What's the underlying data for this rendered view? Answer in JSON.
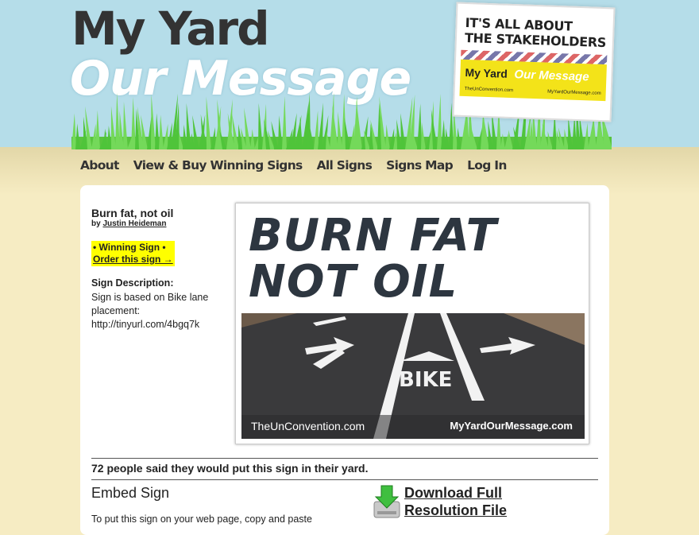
{
  "header": {
    "logo_line1": "My Yard",
    "logo_line2": "Our Message",
    "yard_sign": {
      "headline_line1": "IT'S ALL ABOUT",
      "headline_line2": "THE STAKEHOLDERS",
      "brand_left": "My Yard",
      "brand_right": "Our Message",
      "url_left": "TheUnConvention.com",
      "url_right": "MyYardOurMessage.com"
    }
  },
  "nav": {
    "items": [
      "About",
      "View & Buy Winning Signs",
      "All Signs",
      "Signs Map",
      "Log In"
    ]
  },
  "sign": {
    "title": "Burn fat, not oil",
    "by_prefix": "by",
    "author": "Justin Heideman",
    "winning_label": "• Winning Sign •",
    "order_link": "Order this sign →",
    "description_label": "Sign Description:",
    "description_text": "Sign is based on Bike lane placement: http://tinyurl.com/4bgq7k",
    "image": {
      "text_line1": "BURN FAT",
      "text_line2": "NOT OIL",
      "road_marking": "BIKE",
      "url_left": "TheUnConvention.com",
      "url_right": "MyYardOurMessage.com"
    },
    "count_text": "72 people said they would put this sign in their yard."
  },
  "embed": {
    "title": "Embed Sign",
    "instructions": "To put this sign on your web page, copy and paste"
  },
  "download": {
    "link_text": "Download Full Resolution File",
    "icon": "download-arrow-icon"
  },
  "colors": {
    "sky": "#b5dde9",
    "ground": "#f6ecc3",
    "highlight": "#ffff00",
    "grass": "#4fc43a",
    "yard_sign_yellow": "#f3e319"
  }
}
